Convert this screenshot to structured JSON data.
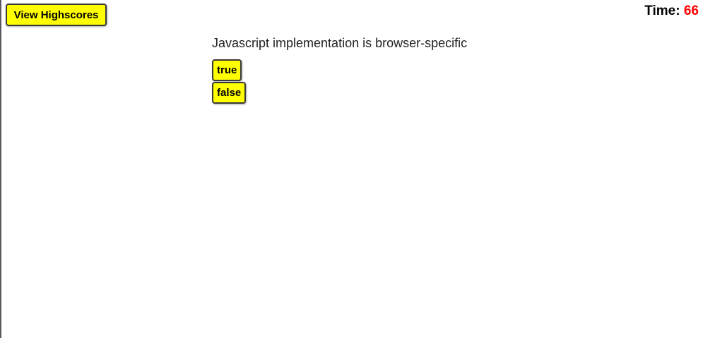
{
  "header": {
    "highscores_label": "View Highscores",
    "timer_label": "Time:",
    "timer_value": "66",
    "colors": {
      "button_bg": "#ffff00",
      "timer_value": "#ff0000"
    }
  },
  "quiz": {
    "question": "Javascript implementation is browser-specific",
    "answers": [
      {
        "label": "true"
      },
      {
        "label": "false"
      }
    ]
  }
}
